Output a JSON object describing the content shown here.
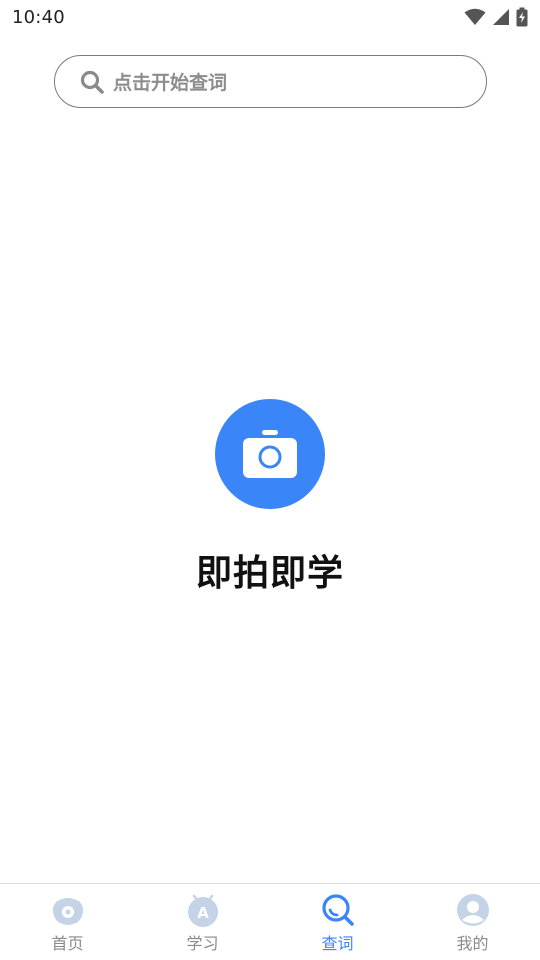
{
  "status_bar": {
    "time": "10:40",
    "icons": [
      "wifi-icon",
      "signal-icon",
      "battery-charging-icon"
    ]
  },
  "search": {
    "placeholder": "点击开始查词",
    "icon": "search-icon"
  },
  "main": {
    "camera_icon": "camera-icon",
    "title": "即拍即学",
    "accent_color": "#3a85f7"
  },
  "bottom_nav": {
    "items": [
      {
        "label": "首页",
        "icon": "home-icon",
        "active": false
      },
      {
        "label": "学习",
        "icon": "study-icon",
        "active": false
      },
      {
        "label": "查词",
        "icon": "lookup-icon",
        "active": true
      },
      {
        "label": "我的",
        "icon": "profile-icon",
        "active": false
      }
    ],
    "active_color": "#3a85f7",
    "inactive_icon_color": "#c5d3e6"
  }
}
